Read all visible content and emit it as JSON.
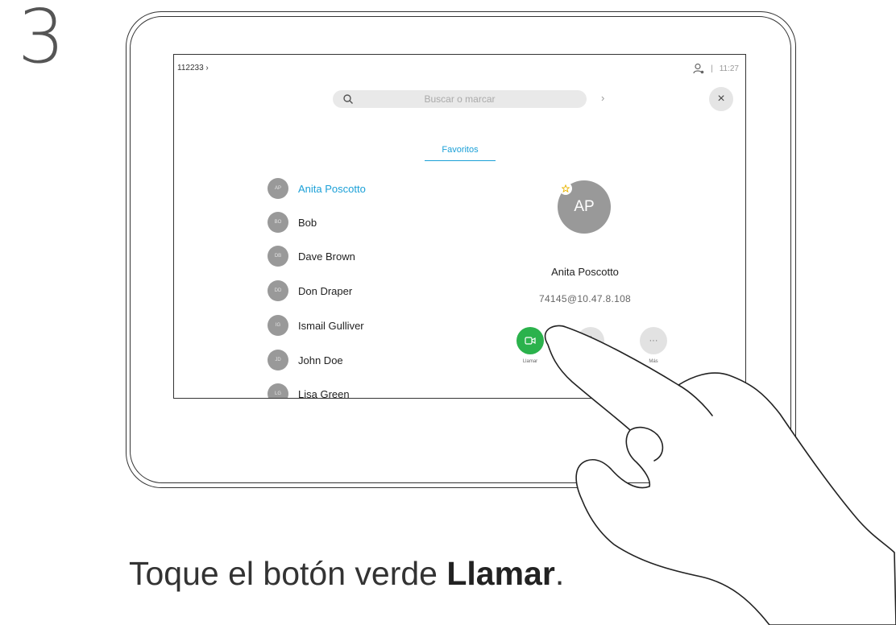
{
  "step": {
    "number": "3"
  },
  "device": {
    "status_bar": {
      "left_label": "112233 ›",
      "time": "11:27",
      "separator": "|"
    },
    "search": {
      "placeholder": "Buscar o marcar",
      "go_glyph": "›"
    },
    "close_glyph": "×",
    "tabs": [
      {
        "label": "Favoritos",
        "active": true
      }
    ],
    "contacts": [
      {
        "initials": "AP",
        "name": "Anita Poscotto",
        "selected": true
      },
      {
        "initials": "BO",
        "name": "Bob"
      },
      {
        "initials": "DB",
        "name": "Dave Brown"
      },
      {
        "initials": "DD",
        "name": "Don Draper"
      },
      {
        "initials": "IG",
        "name": "Ismail Gulliver"
      },
      {
        "initials": "JD",
        "name": "John Doe"
      },
      {
        "initials": "LG",
        "name": "Lisa Green"
      }
    ],
    "detail": {
      "initials": "AP",
      "name": "Anita Poscotto",
      "address": "74145@10.47.8.108",
      "actions": [
        {
          "label": "Llamar",
          "icon": "video-camera-icon",
          "color": "#2bb24c"
        },
        {
          "label": "",
          "icon": "star-icon"
        },
        {
          "label": "Más",
          "icon": "more-icon",
          "glyph": "···"
        }
      ]
    }
  },
  "caption": {
    "text_prefix": "Toque el botón verde ",
    "text_bold": "Llamar",
    "text_suffix": "."
  },
  "colors": {
    "accent_blue": "#1ba0d7",
    "call_green": "#2bb24c",
    "avatar_gray": "#999999"
  }
}
